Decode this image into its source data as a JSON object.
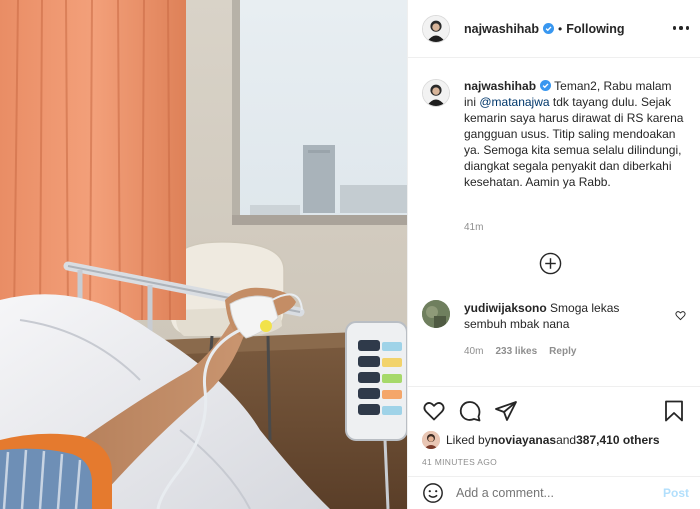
{
  "post": {
    "author": "najwashihab",
    "follow_separator": "•",
    "follow_status": "Following",
    "caption_author": "najwashihab",
    "caption_part1": " Teman2, Rabu malam ini ",
    "caption_mention": "@matanajwa",
    "caption_part2": " tdk tayang dulu. Sejak kemarin saya harus dirawat di RS karena gangguan usus. Titip saling mendoakan ya. Semoga kita semua selalu dilindungi, diangkat segala penyakit dan diberkahi kesehatan. Aamin ya Rabb.",
    "caption_time": "41m"
  },
  "comment": {
    "username": "yudiwijaksono",
    "text": " Smoga lekas sembuh mbak nana",
    "time": "40m",
    "likes": "233 likes",
    "reply": "Reply"
  },
  "likes": {
    "prefix": "Liked by ",
    "user": "noviayanas",
    "middle": " and ",
    "count": "387,410 others"
  },
  "time_ago": "41 MINUTES AGO",
  "add_comment": {
    "placeholder": "Add a comment...",
    "post_label": "Post"
  },
  "colors": {
    "accent_blue": "#0095f6",
    "post_disabled": "#b2dffc",
    "muted_text": "#8e8e8e",
    "mention": "#00376b"
  },
  "icons": [
    "heart-icon",
    "comment-icon",
    "share-icon",
    "bookmark-icon",
    "emoji-icon",
    "more-icon",
    "verified-icon",
    "load-more-icon"
  ]
}
